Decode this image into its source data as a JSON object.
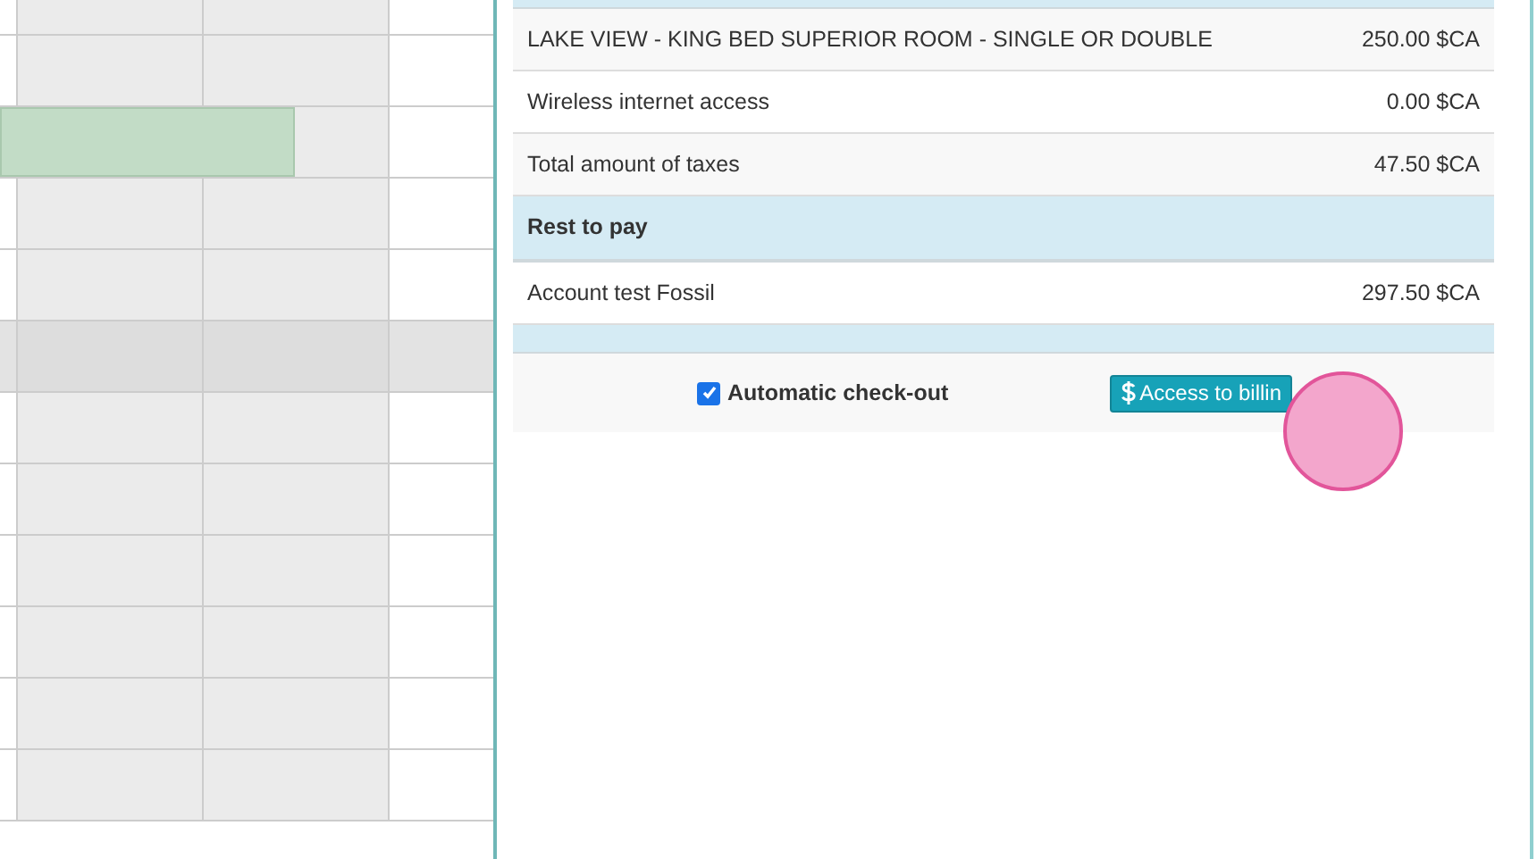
{
  "planning": {
    "rows": [
      {
        "highlighted": false,
        "booking": false
      },
      {
        "highlighted": false,
        "booking": true
      },
      {
        "highlighted": false,
        "booking": false
      },
      {
        "highlighted": false,
        "booking": false
      },
      {
        "highlighted": true,
        "booking": false
      },
      {
        "highlighted": false,
        "booking": false
      },
      {
        "highlighted": false,
        "booking": false
      },
      {
        "highlighted": false,
        "booking": false
      },
      {
        "highlighted": false,
        "booking": false
      },
      {
        "highlighted": false,
        "booking": false
      },
      {
        "highlighted": false,
        "booking": false
      }
    ]
  },
  "billing": {
    "lines": [
      {
        "kind": "item",
        "label": "LAKE VIEW - KING BED SUPERIOR ROOM - SINGLE OR DOUBLE",
        "amount": "250.00 $CA"
      },
      {
        "kind": "item",
        "label": "Wireless internet access",
        "amount": "0.00 $CA"
      },
      {
        "kind": "item",
        "label": "Total amount of taxes",
        "amount": "47.50 $CA"
      },
      {
        "kind": "header",
        "label": "Rest to pay"
      },
      {
        "kind": "item",
        "label": "Account test Fossil",
        "amount": "297.50 $CA"
      },
      {
        "kind": "spacer"
      }
    ],
    "auto_checkout": {
      "label": "Automatic check-out",
      "checked": true
    },
    "billing_button": {
      "label": "Access to billin"
    }
  }
}
